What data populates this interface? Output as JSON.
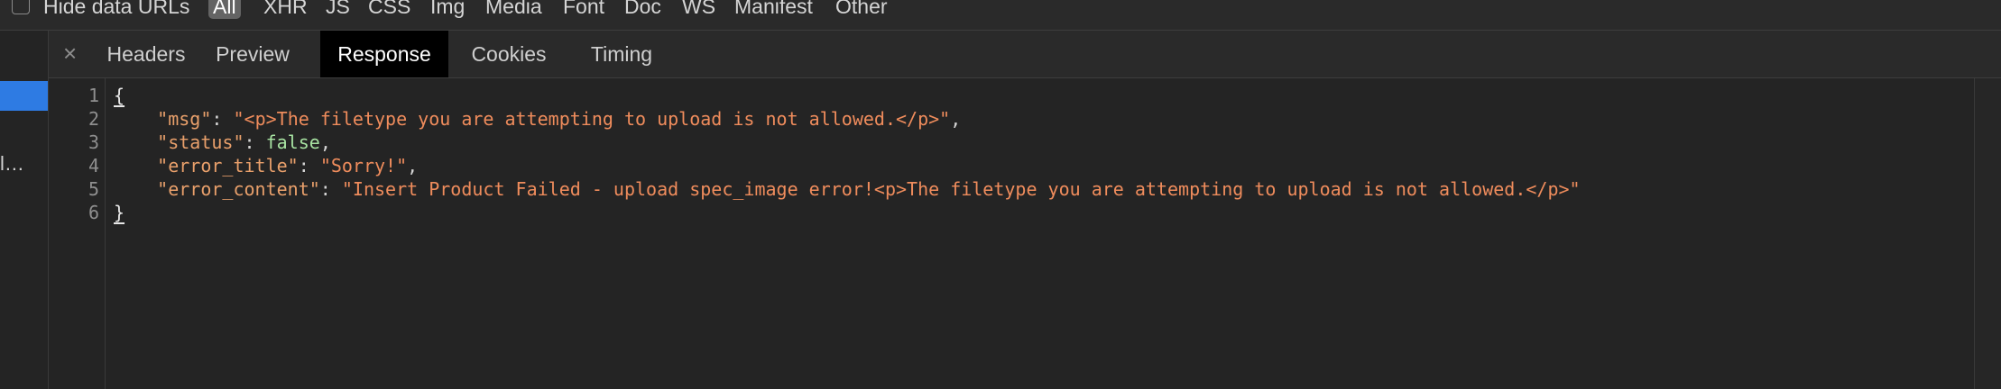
{
  "filter_bar": {
    "hide_data_urls_label": "Hide data URLs",
    "hide_data_urls_checked": false,
    "types": [
      "All",
      "XHR",
      "JS",
      "CSS",
      "Img",
      "Media",
      "Font",
      "Doc",
      "WS",
      "Manifest",
      "Other"
    ],
    "active_type": "All"
  },
  "request_list": {
    "truncated_row_text": "l…"
  },
  "detail_tabs": {
    "close_symbol": "×",
    "tabs": [
      "Headers",
      "Preview",
      "Response",
      "Cookies",
      "Timing"
    ],
    "active_tab": "Response"
  },
  "response": {
    "line_numbers": [
      "1",
      "2",
      "3",
      "4",
      "5",
      "6"
    ],
    "open_brace": "{",
    "close_brace": "}",
    "fields": [
      {
        "key": "\"msg\"",
        "value": "\"<p>The filetype you are attempting to upload is not allowed.</p>\"",
        "type": "string",
        "trailing": ","
      },
      {
        "key": "\"status\"",
        "value": "false",
        "type": "boolean",
        "trailing": ","
      },
      {
        "key": "\"error_title\"",
        "value": "\"Sorry!\"",
        "type": "string",
        "trailing": ","
      },
      {
        "key": "\"error_content\"",
        "value": "\"Insert Product Failed - upload spec_image error!<p>The filetype you are attempting to upload is not allowed.</p>\"",
        "type": "string",
        "trailing": ""
      }
    ]
  },
  "colors": {
    "background": "#242424",
    "toolbar": "#2a2a2a",
    "selection": "#2e7be3",
    "json_key": "#e9a06b",
    "json_string": "#ef8c5c",
    "json_boolean": "#a8e3a2",
    "active_tab_bg": "#000000"
  }
}
